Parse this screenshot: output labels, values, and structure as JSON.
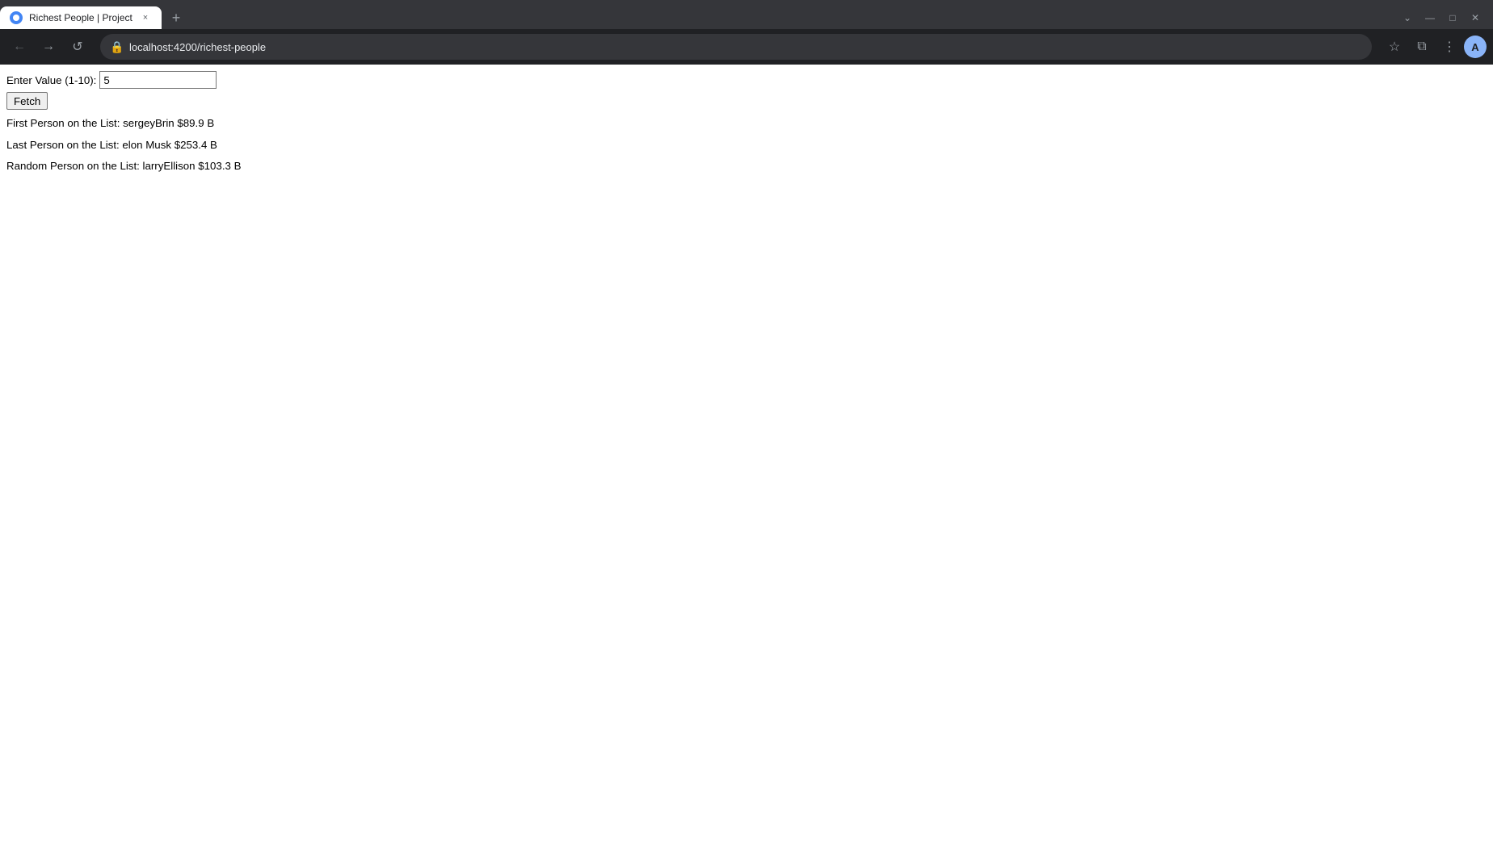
{
  "browser": {
    "tab": {
      "title": "Richest People | Project",
      "favicon_label": "favicon",
      "close_label": "×"
    },
    "new_tab_label": "+",
    "controls": {
      "minimize": "—",
      "maximize": "□",
      "close": "✕",
      "dropdown": "⌄"
    },
    "nav": {
      "back_label": "←",
      "forward_label": "→",
      "reload_label": "↺",
      "url": "localhost:4200/richest-people",
      "bookmark_label": "☆",
      "extensions_label": "⧉",
      "settings_label": "⋮",
      "profile_label": "A"
    }
  },
  "page": {
    "input_label": "Enter Value (1-10):",
    "input_value": "5",
    "input_placeholder": "",
    "fetch_button_label": "Fetch",
    "results": {
      "first": "First Person on the List: sergeyBrin $89.9 B",
      "last": "Last Person on the List: elon Musk $253.4 B",
      "random": "Random Person on the List: larryEllison $103.3 B"
    }
  }
}
